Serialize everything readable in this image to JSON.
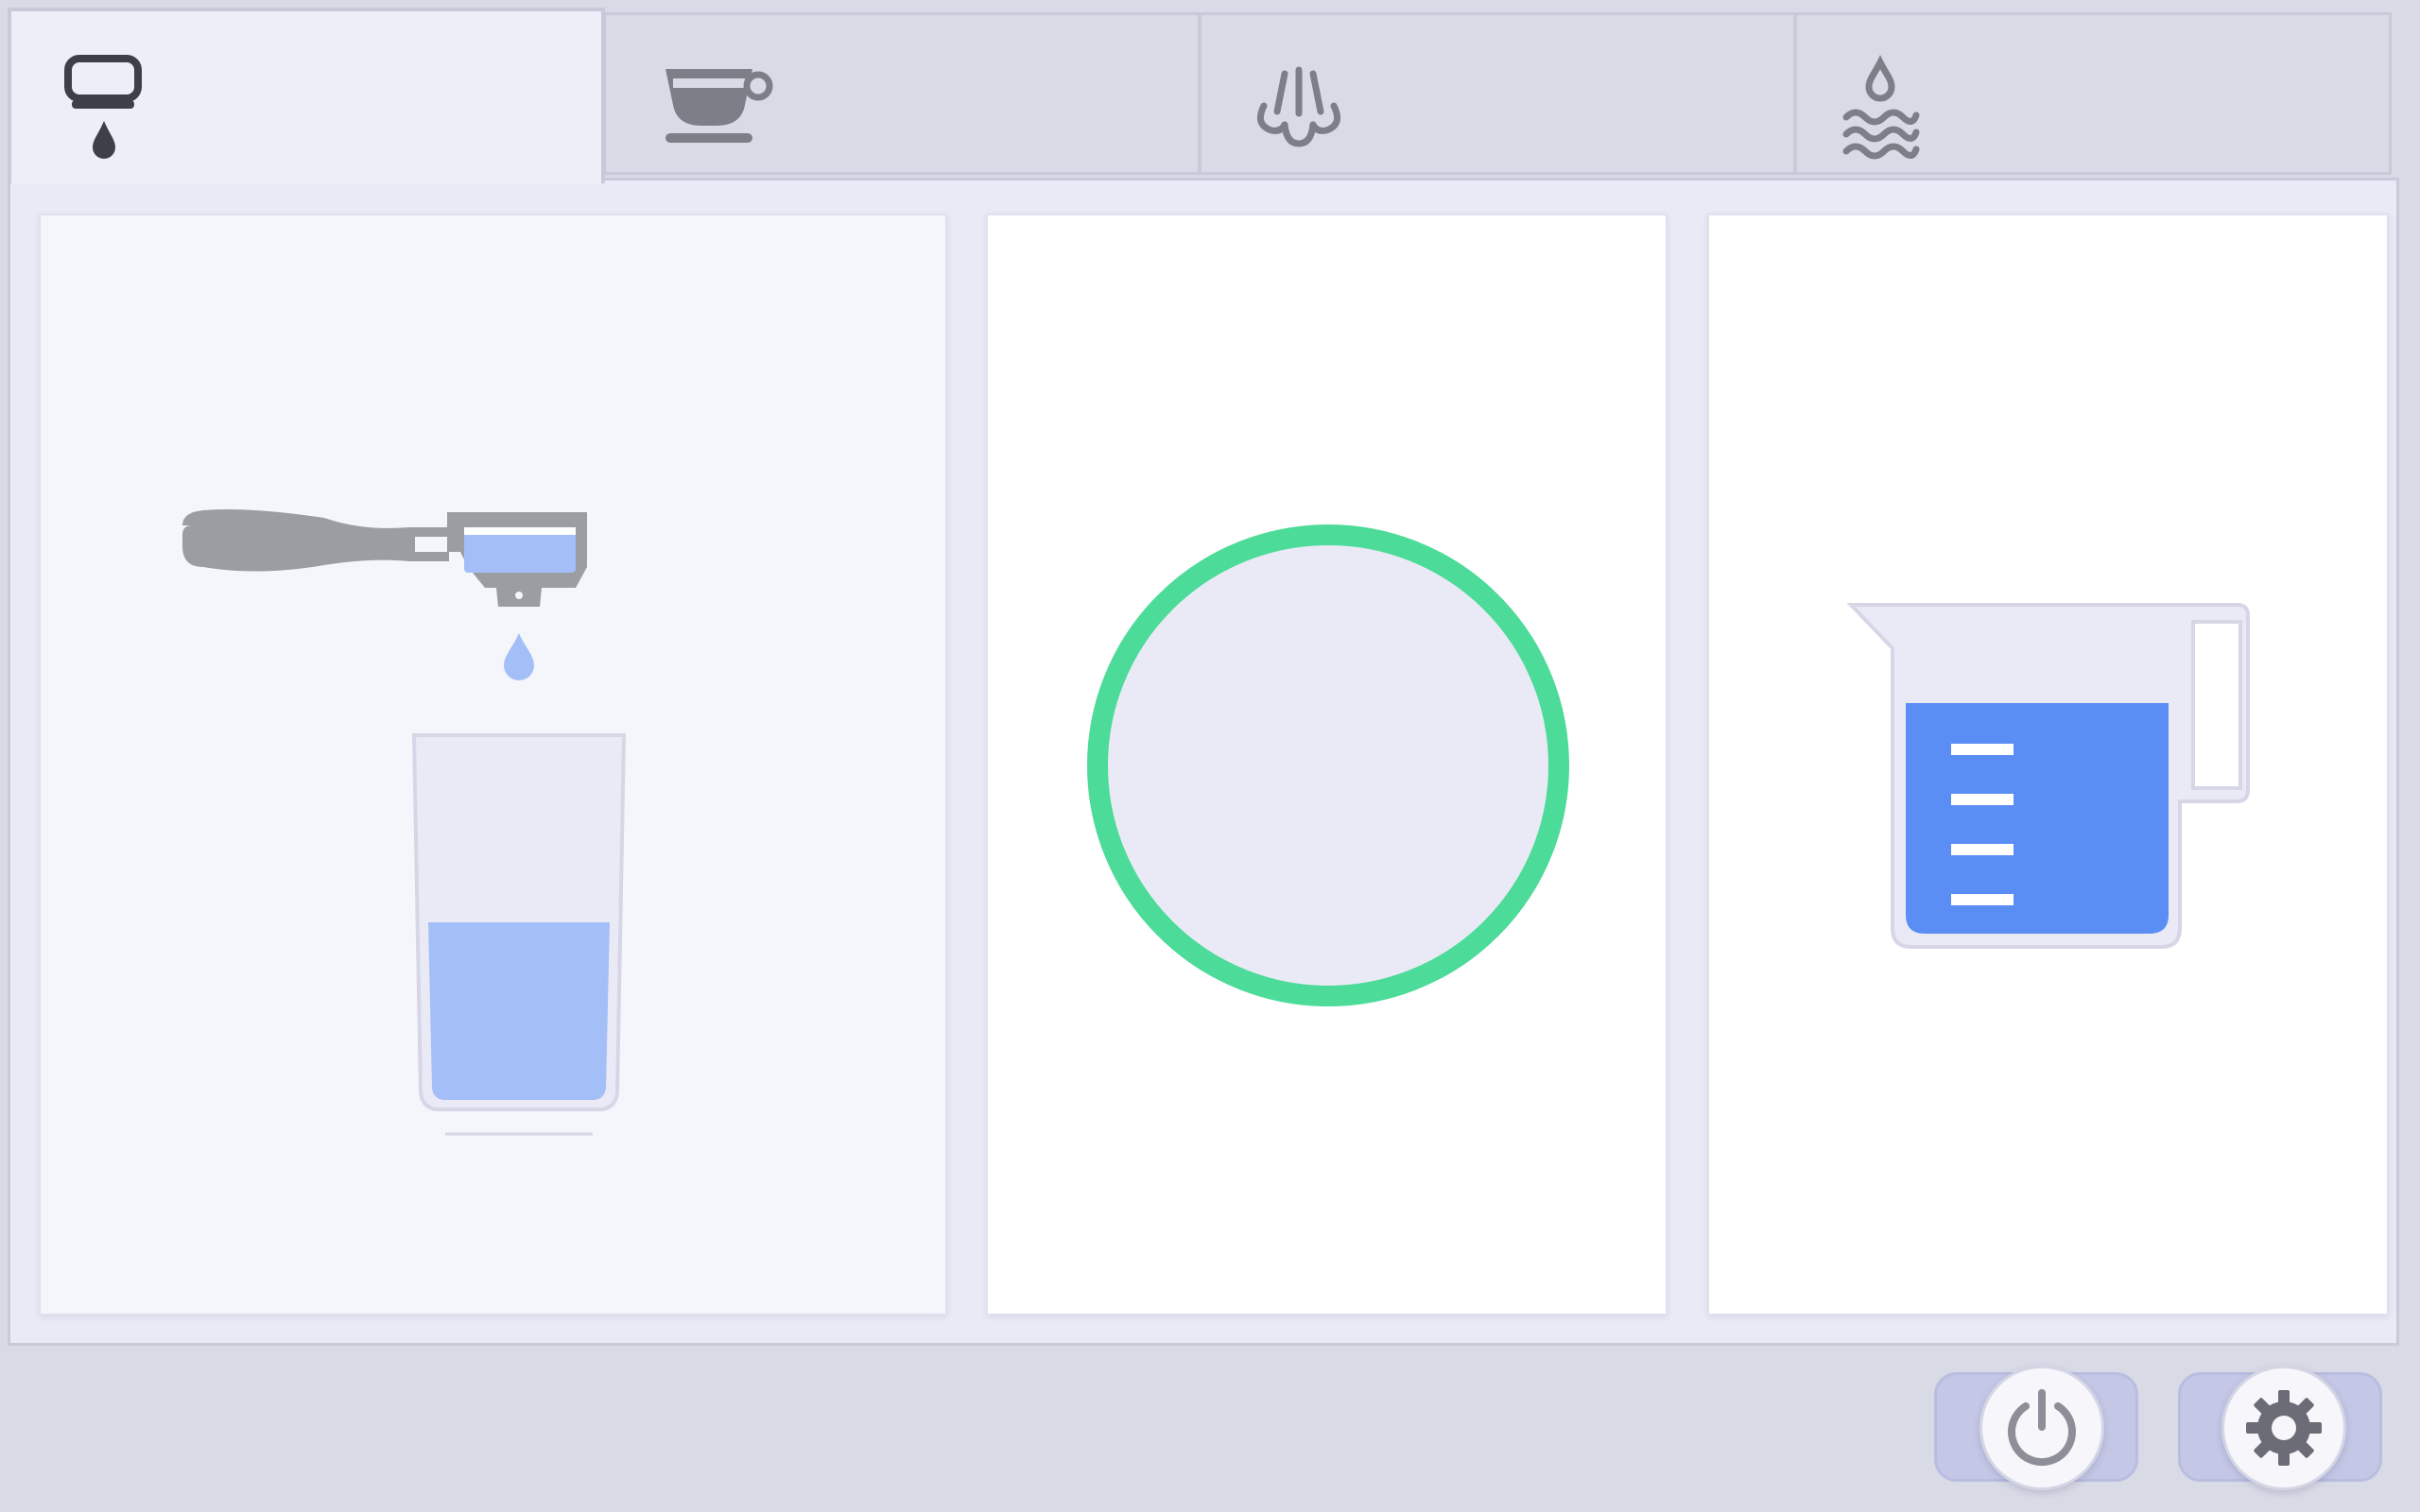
{
  "tabs": [
    {
      "id": "brew",
      "icon": "portafilter-drip-icon",
      "active": true
    },
    {
      "id": "cup",
      "icon": "coffee-cup-icon",
      "active": false
    },
    {
      "id": "steam",
      "icon": "steam-wand-icon",
      "active": false
    },
    {
      "id": "hot-water",
      "icon": "hot-water-icon",
      "active": false
    }
  ],
  "panels": {
    "brew": {
      "illustration": "portafilter-and-glass",
      "glass_fill_fraction": 0.48
    },
    "status": {
      "illustration": "status-ring",
      "ring_color": "#4cdb98",
      "progress_fraction": 1.0
    },
    "water": {
      "illustration": "measuring-jug",
      "fill_fraction": 0.7,
      "tick_marks": 4,
      "water_color": "#5b8ef5"
    }
  },
  "footer": {
    "power_icon": "power-icon",
    "settings_icon": "gear-icon"
  },
  "colors": {
    "background": "#d8dae6",
    "content_background": "#eaeaf6",
    "accent_green": "#4cdb98",
    "water_blue": "#5b8ef5",
    "light_water": "#a4bff7",
    "icon_gray": "#7d7e87"
  }
}
